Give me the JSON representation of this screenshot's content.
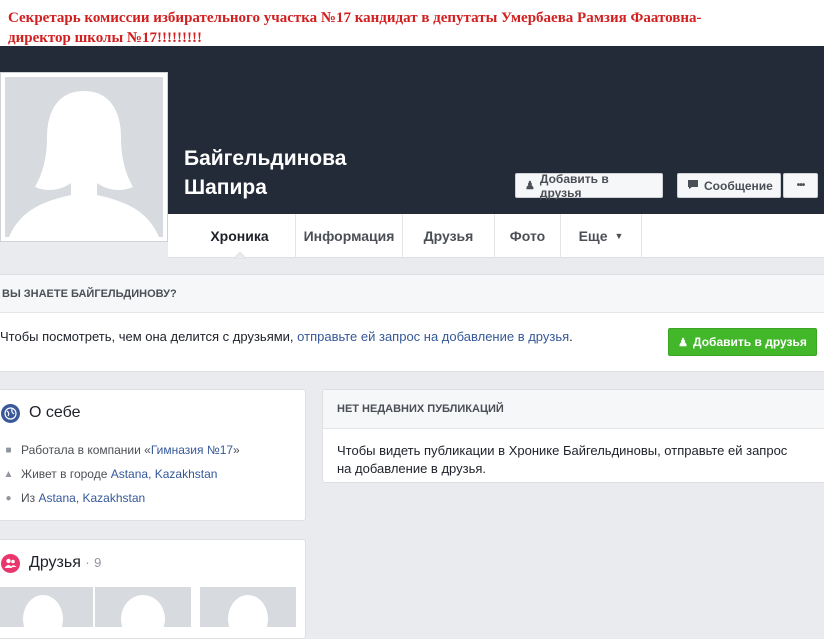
{
  "caption": {
    "line1": "Секретарь комиссии избирательного участка №17 кандидат в депутаты Умербаева Рамзия Фаатовна-",
    "line2": "директор школы №17!!!!!!!!!"
  },
  "profile": {
    "name_line1": "Байгельдинова",
    "name_line2": "Шапира"
  },
  "header_buttons": {
    "add_friend": "Добавить в друзья",
    "message": "Сообщение",
    "more": "•••"
  },
  "tabs": [
    {
      "label": "Хроника"
    },
    {
      "label": "Информация"
    },
    {
      "label": "Друзья"
    },
    {
      "label": "Фото"
    },
    {
      "label": "Еще"
    }
  ],
  "know_box": {
    "heading": "ВЫ ЗНАЕТЕ БАЙГЕЛЬДИНОВУ?",
    "text_prefix": "Чтобы посмотреть, чем она делится с друзьями, ",
    "link": "отправьте ей запрос на добавление в друзья",
    "text_suffix": ".",
    "button": "Добавить в друзья"
  },
  "about": {
    "title": "О себе",
    "work_prefix": "Работала в компании «",
    "work_link": "Гимназия №17",
    "work_suffix": "»",
    "lives_prefix": "Живет в городе ",
    "lives_link": "Astana, Kazakhstan",
    "from_prefix": "Из ",
    "from_link": "Astana, Kazakhstan"
  },
  "friends": {
    "title": "Друзья",
    "separator": "·",
    "count": "9"
  },
  "posts": {
    "heading": "НЕТ НЕДАВНИХ ПУБЛИКАЦИЙ",
    "body": "Чтобы видеть публикации в Хронике Байгельдиновы, отправьте ей запрос на добавление в друзья."
  },
  "colors": {
    "caption_red": "#d21f1f",
    "cover": "#242b38",
    "link": "#365899",
    "green_button": "#42b72a",
    "about_icon": "#3b5998",
    "friends_icon": "#e9366c"
  }
}
